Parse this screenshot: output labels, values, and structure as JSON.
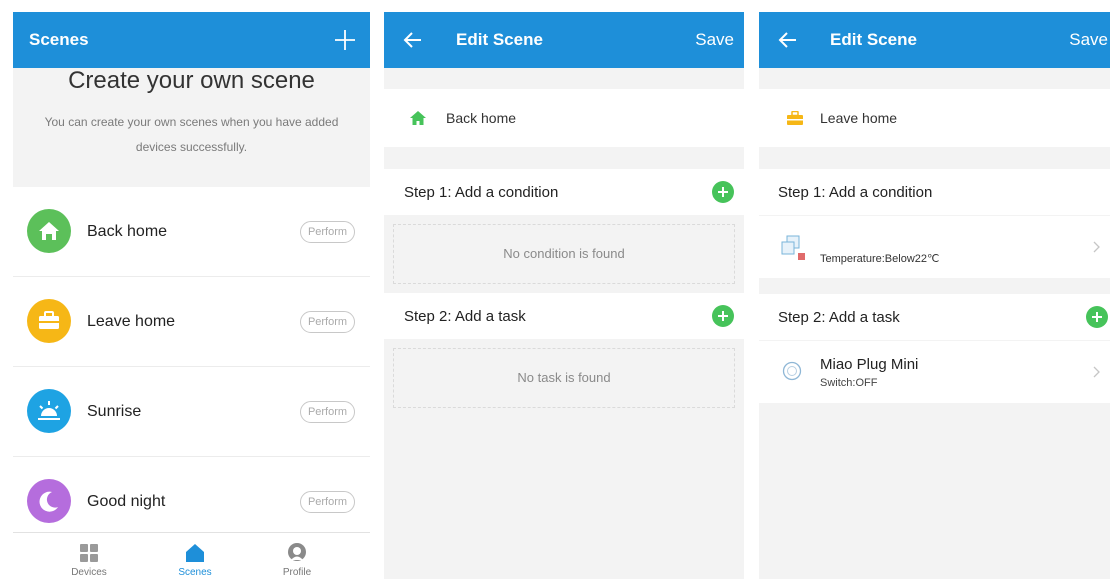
{
  "panel1": {
    "title": "Scenes",
    "heading": "Create your own scene",
    "description": "You can create your own scenes when you have added devices successfully.",
    "scenes": [
      {
        "name": "Back home",
        "action": "Perform",
        "color": "#5cc05a",
        "icon": "home-icon"
      },
      {
        "name": "Leave home",
        "action": "Perform",
        "color": "#f6b716",
        "icon": "briefcase-icon"
      },
      {
        "name": "Sunrise",
        "action": "Perform",
        "color": "#1ea3e3",
        "icon": "sunrise-icon"
      },
      {
        "name": "Good night",
        "action": "Perform",
        "color": "#b56ddd",
        "icon": "moon-icon"
      }
    ],
    "nav": [
      {
        "label": "Devices",
        "icon": "grid-icon",
        "active": false
      },
      {
        "label": "Scenes",
        "icon": "home-icon",
        "active": true
      },
      {
        "label": "Profile",
        "icon": "profile-icon",
        "active": false
      }
    ]
  },
  "panel2": {
    "title": "Edit Scene",
    "save": "Save",
    "scene_name": "Back home",
    "step1": "Step 1: Add a condition",
    "empty_condition": "No condition is found",
    "step2": "Step 2: Add a task",
    "empty_task": "No task is found"
  },
  "panel3": {
    "title": "Edit Scene",
    "save": "Save",
    "scene_name": "Leave home",
    "step1": "Step 1: Add a condition",
    "condition": "Temperature:Below22℃",
    "step2": "Step 2: Add a task",
    "task_name": "Miao Plug Mini",
    "task_status": "Switch:OFF"
  },
  "colors": {
    "accent": "#1e8fd9",
    "add": "#46c35a",
    "active_nav": "#1e8fd9"
  }
}
